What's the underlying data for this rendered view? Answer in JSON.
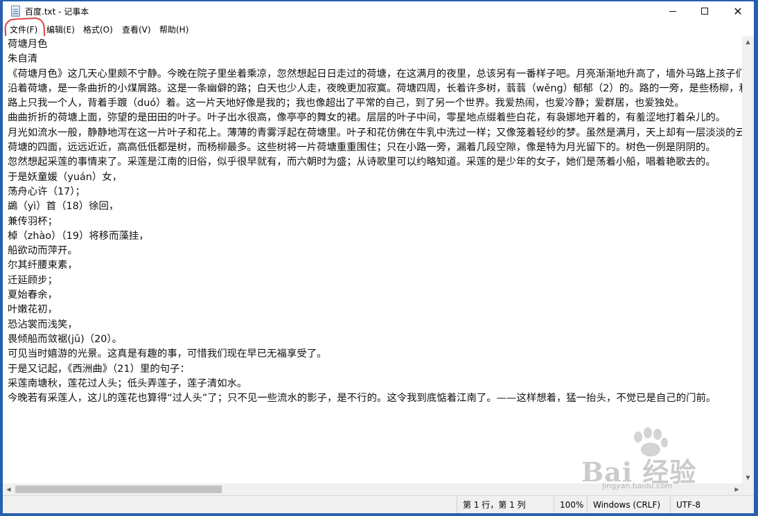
{
  "window": {
    "title": "百度.txt - 记事本",
    "controls": {
      "minimize_icon": "minimize-icon",
      "maximize_icon": "maximize-icon",
      "close_icon": "close-icon",
      "close_glyph": "✕"
    }
  },
  "menu": {
    "file": "文件(F)",
    "edit": "编辑(E)",
    "format": "格式(O)",
    "view": "查看(V)",
    "help": "帮助(H)",
    "highlighted_item": "文件(F)",
    "highlight_color": "#e0403a"
  },
  "editor": {
    "lines": [
      "荷塘月色",
      "朱自清",
      "《荷塘月色》这几天心里颇不宁静。今晚在院子里坐着乘凉，忽然想起日日走过的荷塘，在这满月的夜里，总该另有一番样子吧。月亮渐渐地升高了，墙外马路上孩子们的欢笑，已经听不见了；妻在屋里拍着闰儿，迷迷糊糊地哼着眠歌。我悄悄地披了大衫，带上门出去。",
      "沿着荷塘，是一条曲折的小煤屑路。这是一条幽僻的路；白天也少人走，夜晚更加寂寞。荷塘四周，长着许多树，蓊蓊（wěng）郁郁（2）的。路的一旁，是些杨柳，和一些不知道名字的树。",
      "路上只我一个人，背着手踱（duó）着。这一片天地好像是我的；我也像超出了平常的自己，到了另一个世界。我爱热闹，也爱冷静；爱群居，也爱独处。",
      "曲曲折折的荷塘上面，弥望的是田田的叶子。叶子出水很高，像亭亭的舞女的裙。层层的叶子中间，零星地点缀着些白花，有袅娜地开着的，有羞涩地打着朵儿的。",
      "月光如流水一般，静静地泻在这一片叶子和花上。薄薄的青雾浮起在荷塘里。叶子和花仿佛在牛乳中洗过一样；又像笼着轻纱的梦。虽然是满月，天上却有一层淡淡的云。",
      "荷塘的四面，远远近近，高高低低都是树，而杨柳最多。这些树将一片荷塘重重围住；只在小路一旁，漏着几段空隙，像是特为月光留下的。树色一例是阴阴的。",
      "忽然想起采莲的事情来了。采莲是江南的旧俗，似乎很早就有，而六朝时为盛；从诗歌里可以约略知道。采莲的是少年的女子，她们是荡着小船，唱着艳歌去的。",
      "于是妖童媛（yuán）女，",
      "荡舟心许（17）；",
      "鷁（yì）首（18）徐回，",
      "兼传羽杯；",
      "棹（zhào）（19）将移而藻挂，",
      "船欲动而萍开。",
      "尔其纤腰束素，",
      "迁延顾步；",
      "夏始春余，",
      "叶嫩花初，",
      "恐沾裳而浅笑，",
      "畏倾船而敛裾(jū)（20）。",
      "可见当时嬉游的光景。这真是有趣的事，可惜我们现在早已无福享受了。",
      "于是又记起，《西洲曲》（21）里的句子：",
      "采莲南塘秋，莲花过人头；低头弄莲子，莲子清如水。",
      "今晚若有采莲人，这儿的莲花也算得“过人头”了；只不见一些流水的影子，是不行的。这令我到底惦着江南了。——这样想着，猛一抬头，不觉已是自己的门前。"
    ]
  },
  "scrollbars": {
    "up_arrow": "▲",
    "down_arrow": "▼",
    "left_arrow": "◀",
    "right_arrow": "▶"
  },
  "status": {
    "position": "第 1 行，第 1 列",
    "zoom": "100%",
    "line_ending": "Windows (CRLF)",
    "encoding": "UTF-8"
  },
  "watermark": {
    "brand": "Bai 经验",
    "url": "jingyan.baidu.com"
  },
  "colors": {
    "desktop": "#2b5fa8",
    "window_border": "#1c5eb5"
  }
}
